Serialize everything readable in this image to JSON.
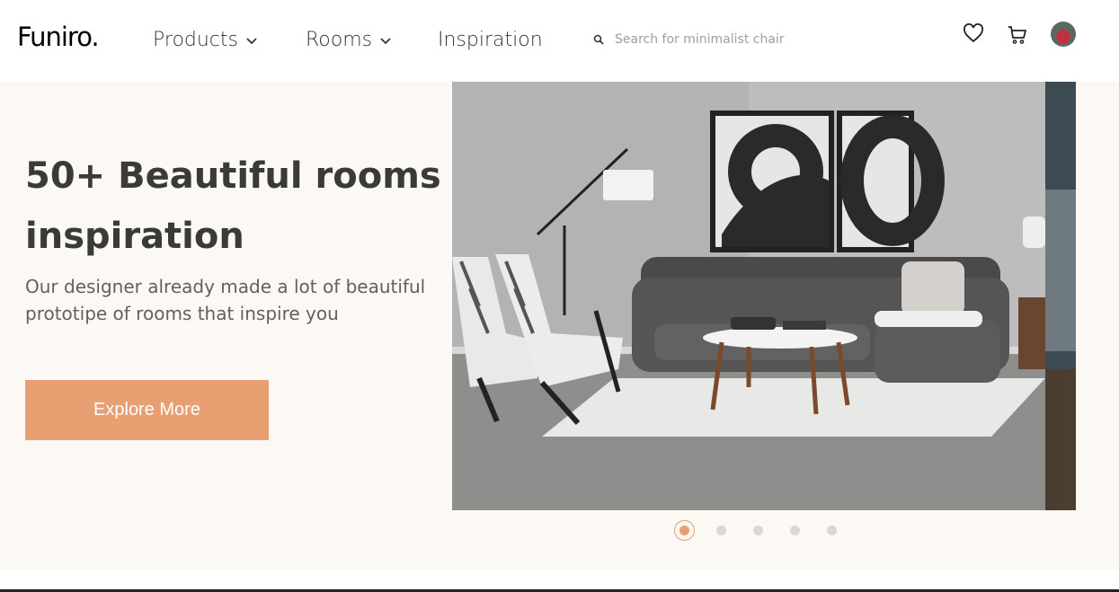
{
  "header": {
    "logo": "Funiro.",
    "nav": [
      {
        "label": "Products",
        "has_dropdown": true
      },
      {
        "label": "Rooms",
        "has_dropdown": true
      },
      {
        "label": "Inspiration",
        "has_dropdown": false
      }
    ],
    "search": {
      "placeholder": "Search for minimalist chair",
      "value": "",
      "icon": "search-icon"
    },
    "icons": [
      "heart-icon",
      "cart-icon"
    ],
    "avatar": "user-avatar"
  },
  "hero": {
    "title": "50+ Beautiful rooms inspiration",
    "subtitle": "Our designer already made a lot of beautiful prototipe of rooms that inspire you",
    "cta_label": "Explore More",
    "slides_total": 5,
    "active_slide": 1
  },
  "colors": {
    "accent": "#e89f71",
    "hero_bg": "#fcf8f3",
    "title": "#3a3a3a",
    "subtitle": "#616161"
  }
}
